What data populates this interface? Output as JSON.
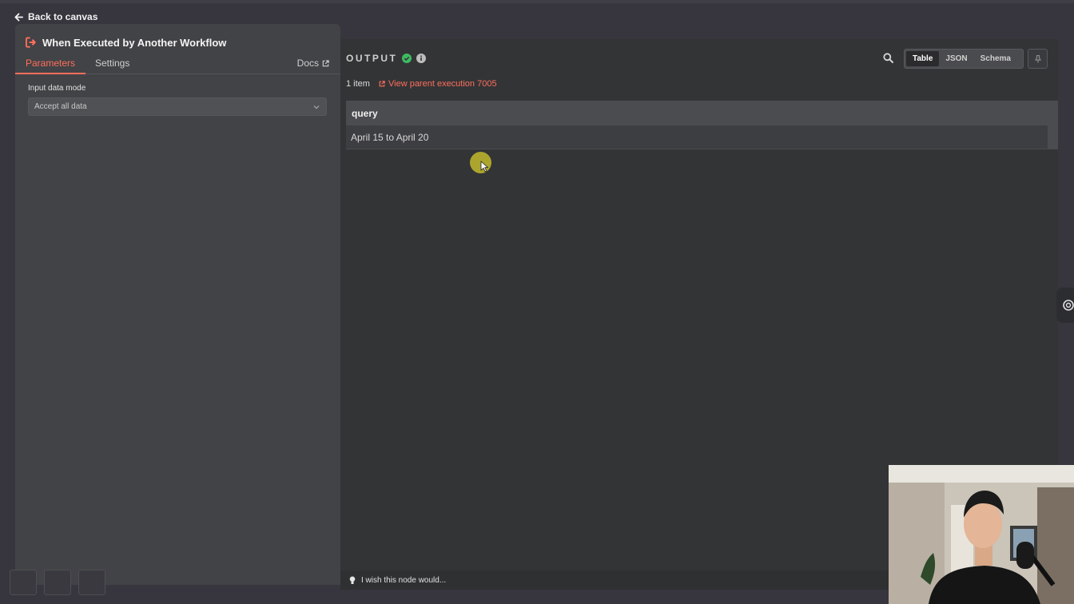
{
  "nav": {
    "back_label": "Back to canvas"
  },
  "node": {
    "title": "When Executed by Another Workflow",
    "tabs": [
      {
        "label": "Parameters",
        "active": true
      },
      {
        "label": "Settings",
        "active": false
      }
    ],
    "docs_label": "Docs",
    "input_mode": {
      "label": "Input data mode",
      "value": "Accept all data"
    }
  },
  "output": {
    "title": "OUTPUT",
    "item_count": "1 item",
    "parent_link": "View parent execution 7005",
    "views": [
      {
        "label": "Table",
        "active": true
      },
      {
        "label": "JSON",
        "active": false
      },
      {
        "label": "Schema",
        "active": false
      }
    ],
    "table": {
      "columns": [
        "query"
      ],
      "rows": [
        [
          "April 15 to April 20"
        ]
      ]
    }
  },
  "feedback": {
    "label": "I wish this node would..."
  },
  "colors": {
    "accent": "#ff6f5c",
    "success": "#3dbb62",
    "panel": "#424346",
    "output_bg": "#333436"
  },
  "icons": [
    "arrow-left-icon",
    "workflow-trigger-icon",
    "external-link-icon",
    "chevron-down-icon",
    "check-circle-icon",
    "info-icon",
    "search-icon",
    "pin-icon",
    "lightbulb-icon",
    "ai-assistant-icon"
  ]
}
